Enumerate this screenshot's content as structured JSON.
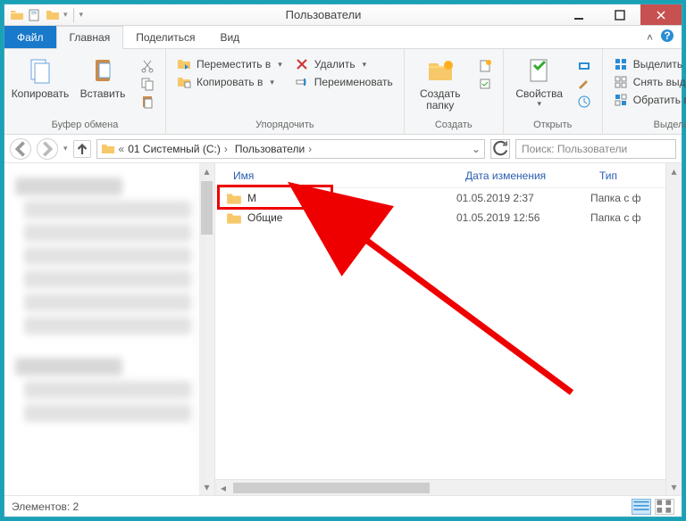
{
  "title": "Пользователи",
  "tabs": {
    "file": "Файл",
    "home": "Главная",
    "share": "Поделиться",
    "view": "Вид"
  },
  "ribbon": {
    "clipboard": {
      "copy": "Копировать",
      "paste": "Вставить",
      "title": "Буфер обмена"
    },
    "organize": {
      "move": "Переместить в",
      "copy_to": "Копировать в",
      "delete": "Удалить",
      "rename": "Переименовать",
      "title": "Упорядочить"
    },
    "new": {
      "new_folder": "Создать\nпапку",
      "title": "Создать"
    },
    "open": {
      "properties": "Свойства",
      "title": "Открыть"
    },
    "select": {
      "select_all": "Выделить все",
      "select_none": "Снять выделение",
      "invert": "Обратить выделение",
      "title": "Выделить"
    }
  },
  "breadcrumb": [
    "01 Системный (C:)",
    "Пользователи"
  ],
  "search_placeholder": "Поиск: Пользователи",
  "columns": {
    "name": "Имя",
    "date": "Дата изменения",
    "type": "Тип"
  },
  "files": [
    {
      "name": "M",
      "date": "01.05.2019 2:37",
      "type": "Папка с ф",
      "highlighted": true
    },
    {
      "name": "Общие",
      "date": "01.05.2019 12:56",
      "type": "Папка с ф"
    }
  ],
  "status": "Элементов: 2",
  "highlight_box": true,
  "arrow_overlay": true
}
